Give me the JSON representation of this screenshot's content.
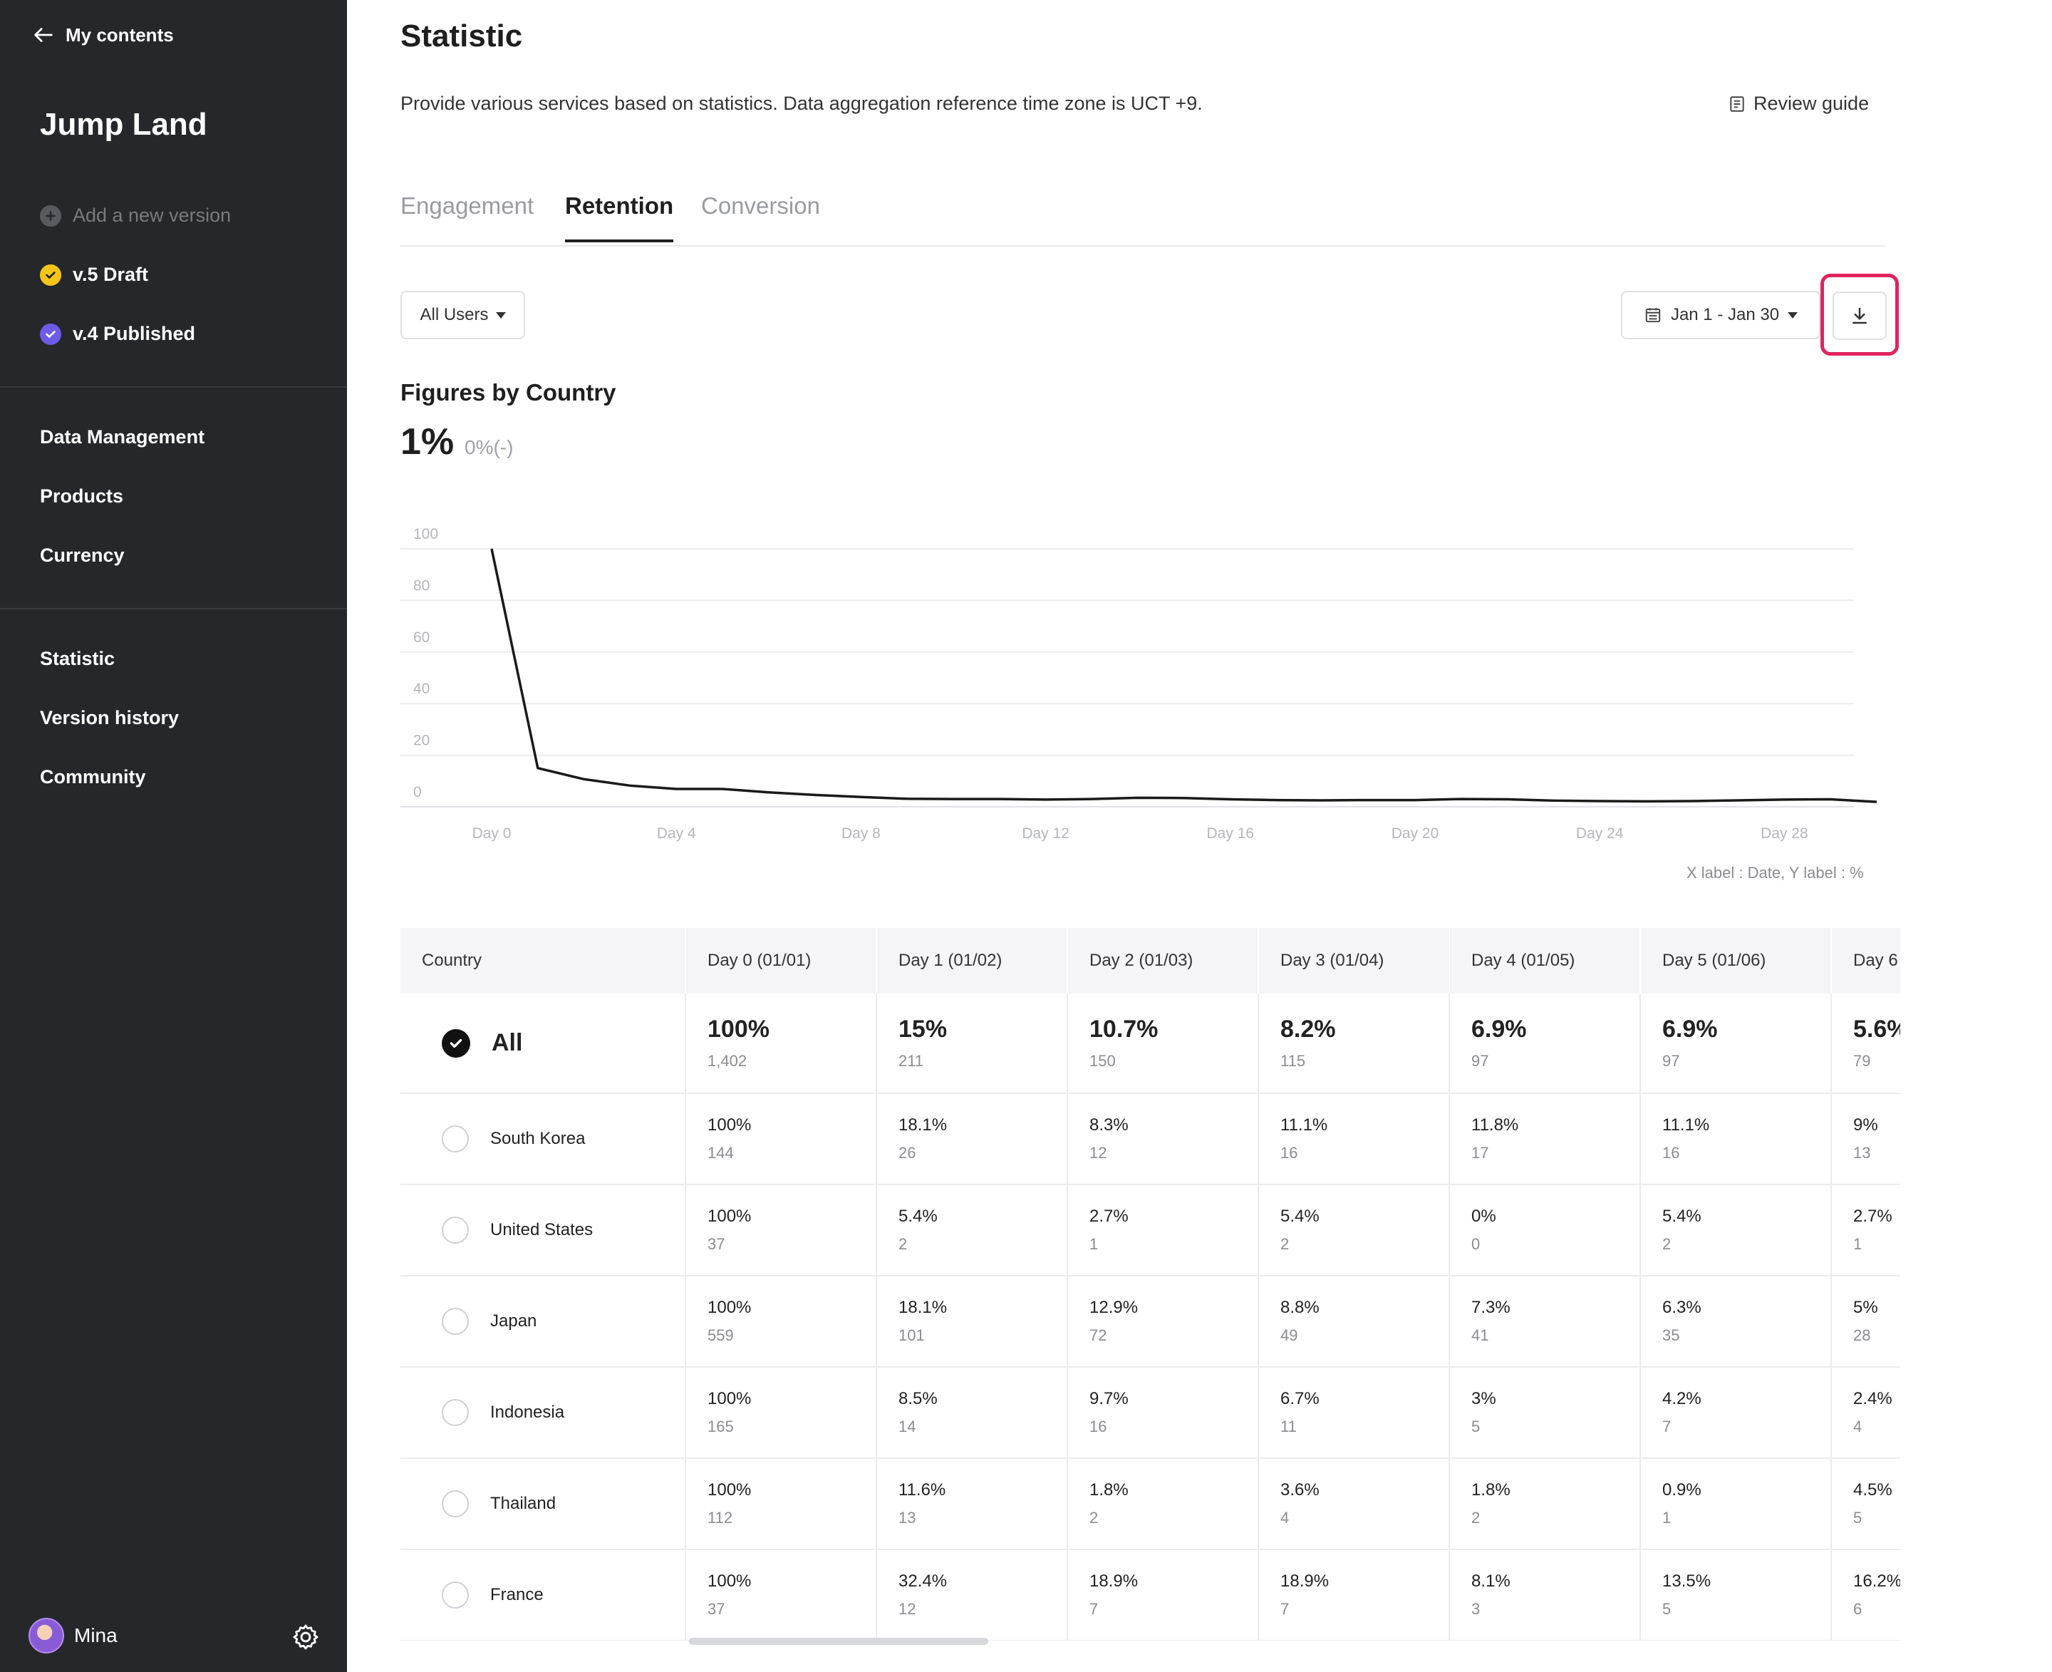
{
  "sidebar": {
    "back_label": "My contents",
    "app_title": "Jump Land",
    "add_version": "Add a new version",
    "versions": [
      {
        "label": "v.5 Draft",
        "color": "#f5c518"
      },
      {
        "label": "v.4 Published",
        "color": "#6c5ce7"
      }
    ],
    "group1": [
      "Data Management",
      "Products",
      "Currency"
    ],
    "group2": [
      "Statistic",
      "Version history",
      "Community"
    ],
    "user_name": "Mina"
  },
  "main": {
    "title": "Statistic",
    "description": "Provide various services based on statistics. Data aggregation reference time zone is UCT +9.",
    "review_guide": "Review guide",
    "tabs": [
      {
        "label": "Engagement",
        "active": false
      },
      {
        "label": "Retention",
        "active": true
      },
      {
        "label": "Conversion",
        "active": false
      }
    ],
    "filter_label": "All Users",
    "date_range": "Jan 1 - Jan 30",
    "figures_title": "Figures by Country",
    "figures_value": "1%",
    "figures_delta": "0%(-)",
    "axis_note": "X label : Date, Y label : %"
  },
  "chart_data": {
    "type": "line",
    "x_ticks": [
      "Day 0",
      "Day 4",
      "Day 8",
      "Day 12",
      "Day 16",
      "Day 20",
      "Day 24",
      "Day 28"
    ],
    "y_ticks": [
      100,
      80,
      60,
      40,
      20,
      0
    ],
    "ylim": [
      0,
      100
    ],
    "grid": true,
    "series": [
      {
        "values": [
          100,
          15,
          10.7,
          8.2,
          6.9,
          6.9,
          5.6,
          4.6,
          3.8,
          3.1,
          3.0,
          3.0,
          2.8,
          3.0,
          3.5,
          3.4,
          2.9,
          2.6,
          2.5,
          2.6,
          2.6,
          3.0,
          2.9,
          2.4,
          2.2,
          2.1,
          2.2,
          2.5,
          2.8,
          2.9,
          1.9
        ]
      }
    ]
  },
  "table": {
    "headers": [
      "Country",
      "Day 0 (01/01)",
      "Day 1 (01/02)",
      "Day 2 (01/03)",
      "Day 3 (01/04)",
      "Day 4 (01/05)",
      "Day 5 (01/06)",
      "Day 6"
    ],
    "rows": [
      {
        "country": "All",
        "selected": true,
        "cells": [
          [
            "100%",
            "1,402"
          ],
          [
            "15%",
            "211"
          ],
          [
            "10.7%",
            "150"
          ],
          [
            "8.2%",
            "115"
          ],
          [
            "6.9%",
            "97"
          ],
          [
            "6.9%",
            "97"
          ],
          [
            "5.6%",
            "79"
          ]
        ]
      },
      {
        "country": "South Korea",
        "selected": false,
        "cells": [
          [
            "100%",
            "144"
          ],
          [
            "18.1%",
            "26"
          ],
          [
            "8.3%",
            "12"
          ],
          [
            "11.1%",
            "16"
          ],
          [
            "11.8%",
            "17"
          ],
          [
            "11.1%",
            "16"
          ],
          [
            "9%",
            "13"
          ]
        ]
      },
      {
        "country": "United States",
        "selected": false,
        "cells": [
          [
            "100%",
            "37"
          ],
          [
            "5.4%",
            "2"
          ],
          [
            "2.7%",
            "1"
          ],
          [
            "5.4%",
            "2"
          ],
          [
            "0%",
            "0"
          ],
          [
            "5.4%",
            "2"
          ],
          [
            "2.7%",
            "1"
          ]
        ]
      },
      {
        "country": "Japan",
        "selected": false,
        "cells": [
          [
            "100%",
            "559"
          ],
          [
            "18.1%",
            "101"
          ],
          [
            "12.9%",
            "72"
          ],
          [
            "8.8%",
            "49"
          ],
          [
            "7.3%",
            "41"
          ],
          [
            "6.3%",
            "35"
          ],
          [
            "5%",
            "28"
          ]
        ]
      },
      {
        "country": "Indonesia",
        "selected": false,
        "cells": [
          [
            "100%",
            "165"
          ],
          [
            "8.5%",
            "14"
          ],
          [
            "9.7%",
            "16"
          ],
          [
            "6.7%",
            "11"
          ],
          [
            "3%",
            "5"
          ],
          [
            "4.2%",
            "7"
          ],
          [
            "2.4%",
            "4"
          ]
        ]
      },
      {
        "country": "Thailand",
        "selected": false,
        "cells": [
          [
            "100%",
            "112"
          ],
          [
            "11.6%",
            "13"
          ],
          [
            "1.8%",
            "2"
          ],
          [
            "3.6%",
            "4"
          ],
          [
            "1.8%",
            "2"
          ],
          [
            "0.9%",
            "1"
          ],
          [
            "4.5%",
            "5"
          ]
        ]
      },
      {
        "country": "France",
        "selected": false,
        "cells": [
          [
            "100%",
            "37"
          ],
          [
            "32.4%",
            "12"
          ],
          [
            "18.9%",
            "7"
          ],
          [
            "18.9%",
            "7"
          ],
          [
            "8.1%",
            "3"
          ],
          [
            "13.5%",
            "5"
          ],
          [
            "16.2%",
            "6"
          ]
        ]
      }
    ]
  }
}
